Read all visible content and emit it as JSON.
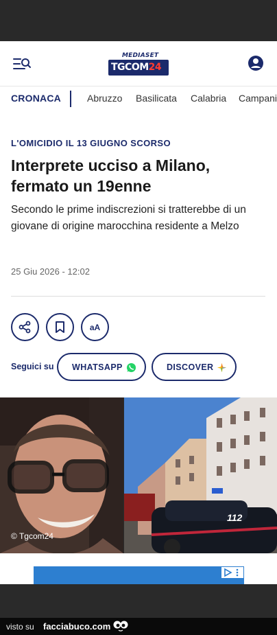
{
  "brand": {
    "top": "MEDIASET",
    "main": "TGCOM",
    "num": "24"
  },
  "nav": {
    "active": "CRONACA",
    "items": [
      "Abruzzo",
      "Basilicata",
      "Calabria",
      "Campania"
    ]
  },
  "article": {
    "kicker": "L'OMICIDIO IL 13 GIUGNO SCORSO",
    "title": "Interprete ucciso a Milano, fermato un 19enne",
    "subtitle": "Secondo le prime indiscrezioni si tratterebbe di un giovane di origine marocchina residente a Melzo",
    "date": "25 Giu 2026 - 12:02"
  },
  "actions": {
    "font_label": "aA"
  },
  "follow": {
    "label": "Seguici su",
    "whatsapp": "WHATSAPP",
    "discover": "DISCOVER"
  },
  "photo": {
    "credit": "© Tgcom24"
  },
  "footer": {
    "prefix": "visto su",
    "brand": "facciabuco.com"
  },
  "colors": {
    "brand_blue": "#1b2a6b",
    "whatsapp_green": "#25d366",
    "ad_blue": "#2d7fd0"
  }
}
